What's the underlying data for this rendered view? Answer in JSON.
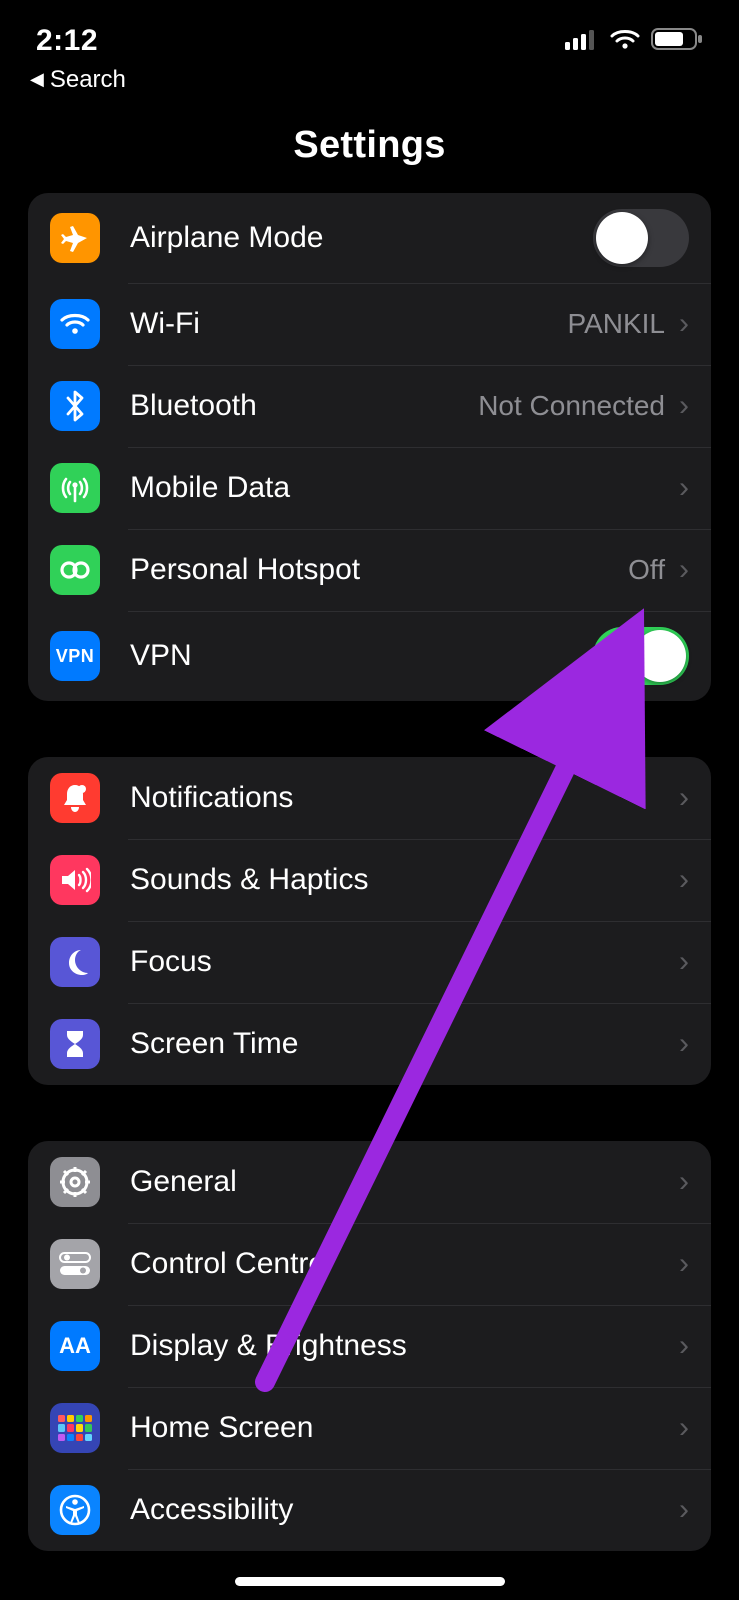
{
  "status": {
    "time": "2:12"
  },
  "back": {
    "label": "Search"
  },
  "page": {
    "title": "Settings"
  },
  "groups": [
    {
      "rows": [
        {
          "label": "Airplane Mode"
        },
        {
          "label": "Wi-Fi",
          "value": "PANKIL"
        },
        {
          "label": "Bluetooth",
          "value": "Not Connected"
        },
        {
          "label": "Mobile Data"
        },
        {
          "label": "Personal Hotspot",
          "value": "Off"
        },
        {
          "label": "VPN"
        }
      ]
    },
    {
      "rows": [
        {
          "label": "Notifications"
        },
        {
          "label": "Sounds & Haptics"
        },
        {
          "label": "Focus"
        },
        {
          "label": "Screen Time"
        }
      ]
    },
    {
      "rows": [
        {
          "label": "General"
        },
        {
          "label": "Control Centre"
        },
        {
          "label": "Display & Brightness"
        },
        {
          "label": "Home Screen"
        },
        {
          "label": "Accessibility"
        }
      ]
    }
  ],
  "toggles": {
    "airplane": false,
    "vpn": true
  },
  "vpn_icon_text": "VPN",
  "aa_icon_text": "AA",
  "annotation": {
    "arrow_color": "#9b28e0"
  }
}
